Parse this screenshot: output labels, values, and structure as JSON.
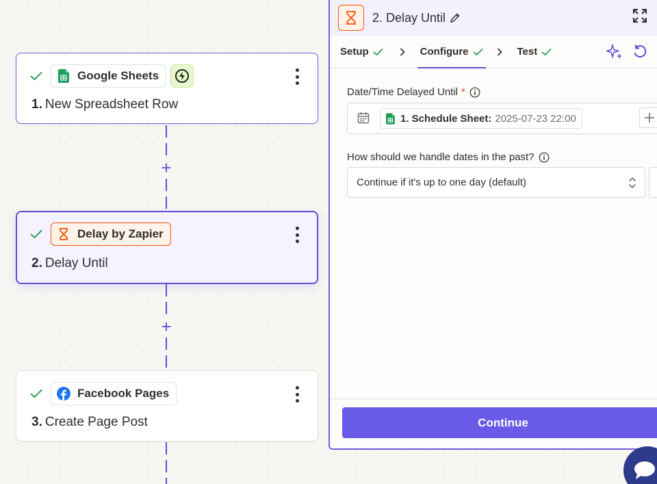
{
  "canvas": {
    "steps": [
      {
        "number": "1.",
        "title": "New Spreadsheet Row",
        "app": "Google Sheets",
        "app_icon": "google-sheets-icon",
        "trigger_icon": "lightning-icon",
        "status": "check-icon"
      },
      {
        "number": "2.",
        "title": "Delay Until",
        "app": "Delay by Zapier",
        "app_icon": "hourglass-icon",
        "status": "check-icon"
      },
      {
        "number": "3.",
        "title": "Create Page Post",
        "app": "Facebook Pages",
        "app_icon": "facebook-icon",
        "status": "check-icon"
      }
    ],
    "add_step_label": "+"
  },
  "panel": {
    "app_icon": "hourglass-icon",
    "title": "2. Delay Until",
    "tabs": [
      {
        "label": "Setup",
        "done": true
      },
      {
        "label": "Configure",
        "done": true,
        "active": true
      },
      {
        "label": "Test",
        "done": true
      }
    ],
    "fields": {
      "date": {
        "label": "Date/Time Delayed Until",
        "required_mark": "*",
        "pill_label": "1. Schedule Sheet:",
        "pill_value": "2025-07-23 22:00"
      },
      "past": {
        "label": "How should we handle dates in the past?",
        "value": "Continue if it's up to one day (default)"
      }
    },
    "continue_label": "Continue"
  },
  "colors": {
    "accent": "#5b4fd6",
    "button": "#695be8",
    "zapier_orange": "#ff4f00",
    "success": "#2e9e5b",
    "sheets_green": "#1e9e5a",
    "facebook_blue": "#1877f2"
  }
}
